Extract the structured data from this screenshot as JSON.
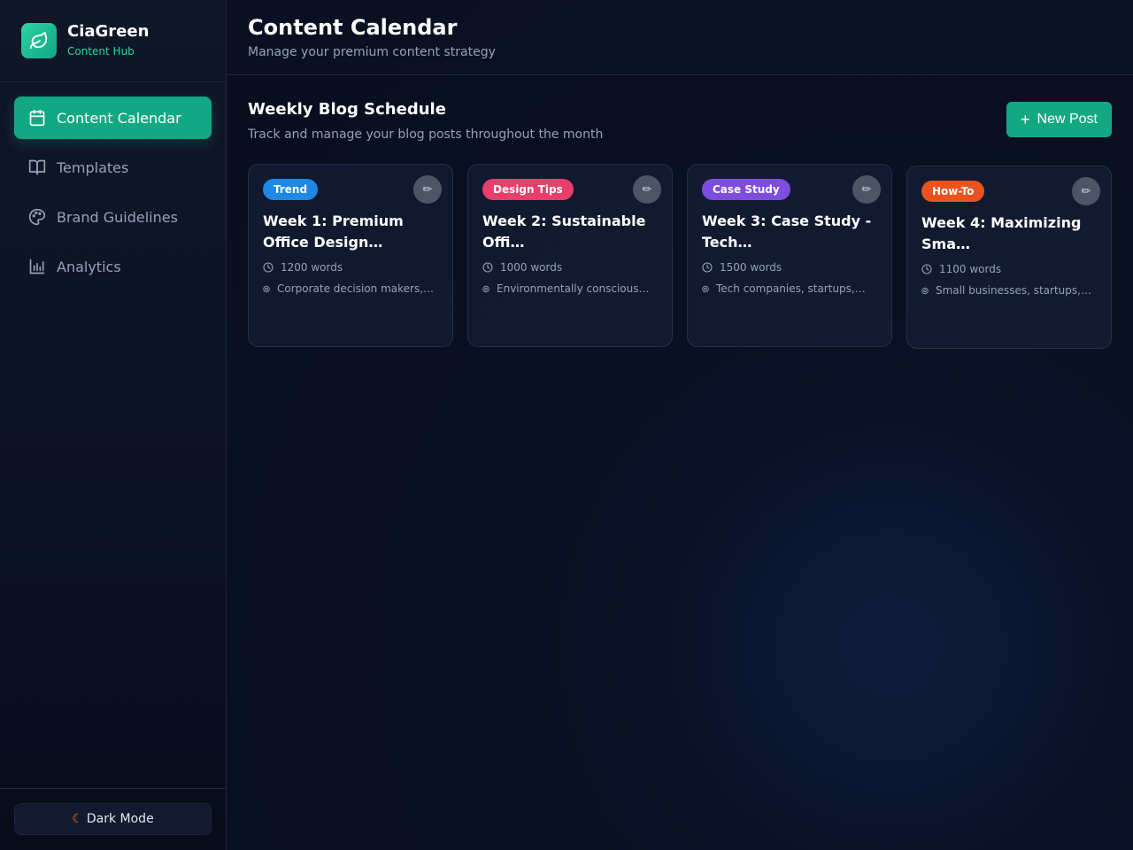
{
  "brand": {
    "name": "CiaGreen",
    "subtitle": "Content Hub",
    "logo_icon": "leaf-icon"
  },
  "sidebar": {
    "items": [
      {
        "label": "Content Calendar",
        "icon": "calendar-icon",
        "active": true
      },
      {
        "label": "Templates",
        "icon": "book-icon",
        "active": false
      },
      {
        "label": "Brand Guidelines",
        "icon": "palette-icon",
        "active": false
      },
      {
        "label": "Analytics",
        "icon": "bar-chart-icon",
        "active": false
      }
    ],
    "dark_mode_label": "Dark Mode",
    "dark_mode_icon": "moon-icon"
  },
  "header": {
    "title": "Content Calendar",
    "subtitle": "Manage your premium content strategy"
  },
  "section": {
    "title": "Weekly Blog Schedule",
    "subtitle": "Track and manage your blog posts throughout the month",
    "new_post_label": "New Post"
  },
  "cards": [
    {
      "tag": "Trend",
      "tag_color": "#1e88e5",
      "title": "Week 1: Premium Office Design…",
      "words": "1200 words",
      "audience": "Corporate decision makers,…"
    },
    {
      "tag": "Design Tips",
      "tag_color": "#e83e6b",
      "title": "Week 2: Sustainable Offi…",
      "words": "1000 words",
      "audience": "Environmentally conscious…"
    },
    {
      "tag": "Case Study",
      "tag_color": "#7c4ddf",
      "title": "Week 3: Case Study - Tech…",
      "words": "1500 words",
      "audience": "Tech companies, startups,…"
    },
    {
      "tag": "How-To",
      "tag_color": "#e8531f",
      "title": "Week 4: Maximizing Sma…",
      "words": "1100 words",
      "audience": "Small businesses, startups,…"
    }
  ],
  "colors": {
    "accent": "#13a884",
    "background": "#0b1122",
    "muted_text": "#94a3b8"
  }
}
